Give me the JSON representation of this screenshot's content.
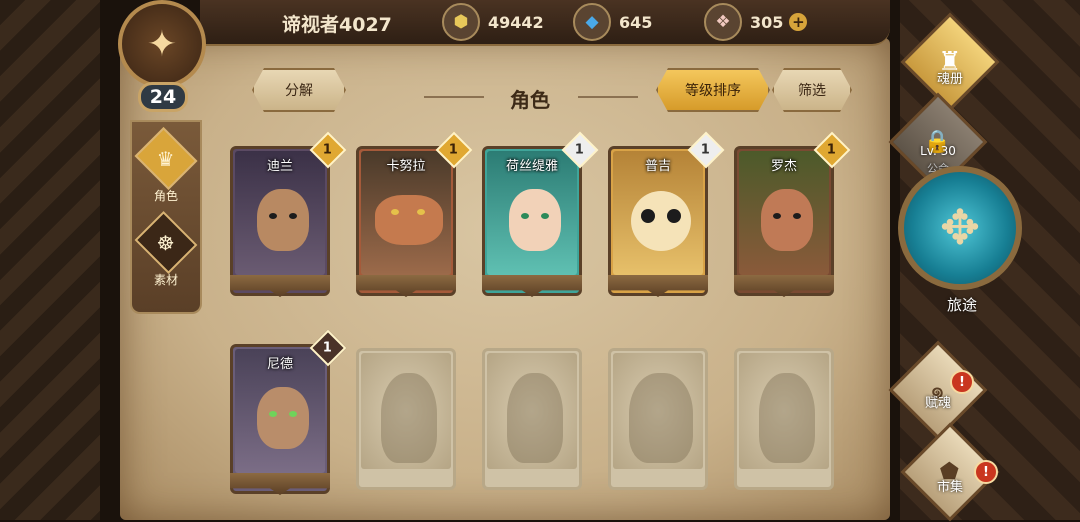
{
  "player": {
    "name": "谛视者4027",
    "level": "24"
  },
  "resources": {
    "gold": {
      "value": "49442",
      "icon": "coin-icon"
    },
    "crystal": {
      "value": "645",
      "icon": "crystal-icon"
    },
    "gem": {
      "value": "305",
      "icon": "gem-icon",
      "add": "+"
    }
  },
  "sidenav": {
    "items": [
      {
        "label": "角色",
        "icon": "character-icon",
        "active": true
      },
      {
        "label": "素材",
        "icon": "material-icon",
        "active": false
      }
    ]
  },
  "header": {
    "title": "角色",
    "decompose_label": "分解",
    "sort_label": "等级排序",
    "filter_label": "筛选"
  },
  "cards": [
    {
      "name": "迪兰",
      "badge": "1",
      "badge_style": "gold",
      "color": "#5b4a63"
    },
    {
      "name": "卡努拉",
      "badge": "1",
      "badge_style": "gold",
      "color": "#a55a3a"
    },
    {
      "name": "荷丝缇雅",
      "badge": "1",
      "badge_style": "silver",
      "color": "#3fa59a"
    },
    {
      "name": "普吉",
      "badge": "1",
      "badge_style": "silver",
      "color": "#d9a347"
    },
    {
      "name": "罗杰",
      "badge": "1",
      "badge_style": "gold",
      "color": "#7a4a32"
    },
    {
      "name": "尼德",
      "badge": "1",
      "badge_style": "dark",
      "color": "#6a5d78"
    }
  ],
  "locked_count": 4,
  "right_menu": {
    "soul_book": "魂册",
    "notice_lock": "Lv. 30",
    "notice": "公会",
    "journey": "旅途",
    "talent": "赋魂",
    "market": "市集",
    "alert": "!"
  }
}
